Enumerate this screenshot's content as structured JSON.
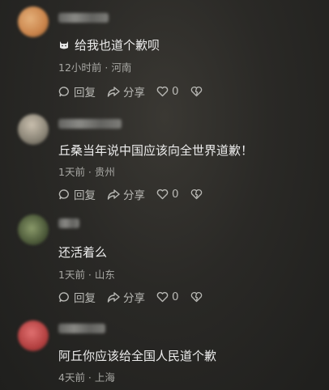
{
  "comments": [
    {
      "text": "给我也道个歉呗",
      "has_emoji": true,
      "meta": "12小时前 · 河南",
      "avatar_colors": [
        "#c9834a",
        "#e4b07a"
      ]
    },
    {
      "text": "丘桑当年说中国应该向全世界道歉！",
      "has_emoji": false,
      "meta": "1天前 · 贵州",
      "avatar_colors": [
        "#8a8476",
        "#b8b0a0"
      ]
    },
    {
      "text": "还活着么",
      "has_emoji": false,
      "meta": "1天前 · 山东",
      "avatar_colors": [
        "#4d5a3a",
        "#7a8a5a"
      ]
    },
    {
      "text": "阿丘你应该给全国人民道个歉",
      "has_emoji": false,
      "meta": "4天前 · 上海",
      "avatar_colors": [
        "#b34040",
        "#d86060"
      ]
    }
  ],
  "actions": {
    "reply": "回复",
    "share": "分享",
    "like_count": "0"
  },
  "icons": [
    "reply-icon",
    "share-icon",
    "like-icon",
    "dislike-icon",
    "cat-emoji-icon"
  ]
}
